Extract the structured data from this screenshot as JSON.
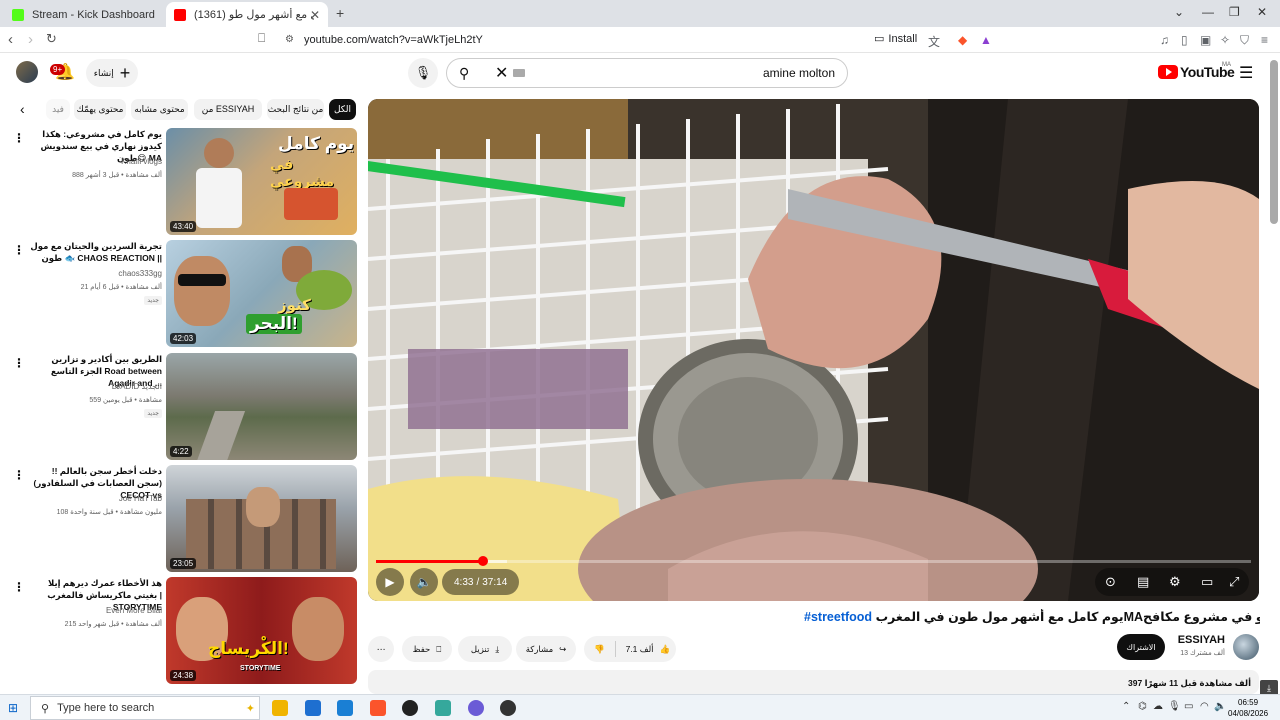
{
  "browser": {
    "tabs": [
      {
        "title": "Stream - Kick Dashboard"
      },
      {
        "title": "(1361) يوم كامل مع أشهر مول طو"
      }
    ],
    "url": "youtube.com/watch?v=aWkTjeLh2tY",
    "install_label": "Install"
  },
  "header": {
    "notification_count": "9+",
    "create_label": "إنشاء",
    "search_value": "amine molton",
    "logo_text": "YouTube",
    "country_code": "MA"
  },
  "chips": [
    "الكل",
    "من نتائج البحث",
    "من ESSIYAH",
    "محتوى مشابه",
    "محتوى يهمّك",
    "فيد"
  ],
  "related": [
    {
      "title": "يوم كامل في مشروعي: هكذا كيدوز نهاري في بيع سندويش طون😋 MA",
      "channel": "Khalfi vlogs",
      "meta": "888 ألف مشاهدة • قبل 3 أشهر",
      "duration": "43:40",
      "thumb_text": [
        "يوم كامل",
        "في مشروعي"
      ],
      "new_badge": ""
    },
    {
      "title": "تجربة السردين والحيتان مع مول طون 🐟 CHAOS REACTION ||",
      "channel": "chaos333gg",
      "meta": "21 ألف مشاهدة • قبل 6 أيام",
      "duration": "42:03",
      "thumb_text": [
        "كنوز",
        "البحر!"
      ],
      "new_badge": "جديد"
    },
    {
      "title": "الطريق بين أكادير و تزارين الجزء التاسع Road between Agadir and ...",
      "channel": "LJADID الجديد",
      "meta": "559 مشاهدة • قبل يومين",
      "duration": "4:22",
      "thumb_text": [],
      "new_badge": "جديد"
    },
    {
      "title": "دخلت أخطر سجن بالعالم !! (سجن العصابات في السلفادور) CECOT vs",
      "channel": "Joe HaTTab",
      "meta": "108 مليون مشاهدة • قبل سنة واحدة",
      "duration": "23:05",
      "thumb_text": [],
      "new_badge": ""
    },
    {
      "title": "هذ الأخطاء عمرك ديرهم إيلا بغيتي ماكريساش فالمغرب | STORYTIME",
      "channel": "Even More Bilal",
      "meta": "215 ألف مشاهدة • قبل شهر واحد",
      "duration": "24:38",
      "thumb_text": [
        "الكْريساج!",
        "STORYTIME"
      ],
      "new_badge": ""
    }
  ],
  "player": {
    "current_time": "4:33",
    "separator": "/",
    "total_time": "37:14",
    "progress_fraction": 0.122,
    "buffered_fraction": 0.15
  },
  "video": {
    "title_text": "يوم كامل مع أشهر مول طون في المغربMAها كفاش كيدوز نهارو في مشروع مكافح 💪",
    "hashtag": "#streetfood",
    "likes": "7.1 ألف",
    "share_label": "مشاركة",
    "download_label": "تنزيل",
    "save_label": "حفظ",
    "channel_name": "ESSIYAH",
    "channel_subs": "13 ألف مشترك",
    "subscribe_label": "الاشتراك",
    "desc_meta": "397 ألف مشاهدة  قبل 11 شهرًا"
  },
  "taskbar": {
    "search_placeholder": "Type here to search",
    "time": "06:59",
    "date": "04/08/2026"
  },
  "colors": {
    "accent": "#ff0000",
    "link": "#065fd4",
    "chip_active": "#0f0f0f"
  }
}
